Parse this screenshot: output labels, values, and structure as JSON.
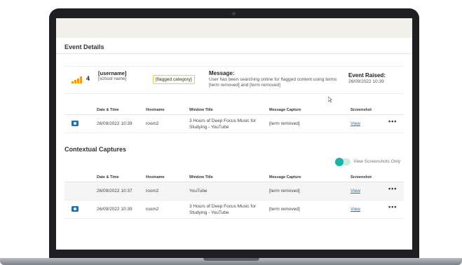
{
  "event_details": {
    "title": "Event Details",
    "severity": "4",
    "user_name": "[username]",
    "user_sub": [
      "[school name]",
      ""
    ],
    "category_tag": "[flagged category]",
    "message_label": "Message:",
    "message_text": "User has been searching online for flagged content using terms [term removed] and [term removed]",
    "raised_label": "Event Raised:",
    "raised_value": "26/09/2022 10:39",
    "table": {
      "headers": [
        "Date & Time",
        "Hostname",
        "Window Title",
        "Message Capture",
        "Screenshot"
      ],
      "rows": [
        {
          "date": "26/09/2022 10:39",
          "host": "room2",
          "title": "3 Hours of Deep Focus Music for Studying - YouTube",
          "capture": "[term removed]",
          "screenshot": "View",
          "more": "•••"
        }
      ]
    }
  },
  "contextual": {
    "title": "Contextual Captures",
    "toggle_label": "View Screenshots Only",
    "toggle_on": true,
    "table": {
      "headers": [
        "Date & Time",
        "Hostname",
        "Window Title",
        "Message Capture",
        "Screenshot"
      ],
      "rows": [
        {
          "date": "26/09/2022 10:37",
          "host": "room2",
          "title": "YouTube",
          "capture": "[term removed]",
          "screenshot": "View",
          "more": "•••"
        },
        {
          "date": "26/09/2022 10:39",
          "host": "room2",
          "title": "3 Hours of Deep Focus Music for Studying - YouTube",
          "capture": "[term removed]",
          "screenshot": "View",
          "more": "•••"
        }
      ]
    }
  },
  "colors": {
    "accent": "#1f6fb2",
    "severity": "#f09a1a",
    "toggle": "#1ab3a6",
    "tag_border": "#f2c94c"
  },
  "icons": {
    "severity": "signal-bars-icon",
    "camera": "camera-icon",
    "more": "more-dots-icon",
    "cursor": "mouse-cursor-icon"
  }
}
